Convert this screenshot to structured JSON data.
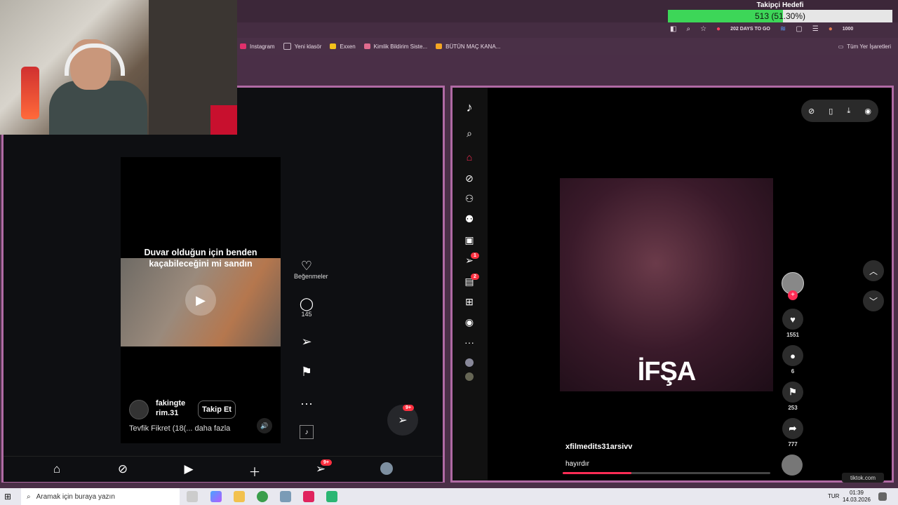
{
  "follower_goal": {
    "title": "Takipçi Hedefi",
    "text": "513 (51.30%)",
    "progress_fraction": 0.513
  },
  "toolbar": {
    "day_counter": "202 DAYS TO GO",
    "counter": "1000"
  },
  "bookmarks": {
    "items": [
      {
        "label": "Instagram",
        "color": "#e1306c"
      },
      {
        "label": "Yeni klasör",
        "color": "#c9b8c5"
      },
      {
        "label": "Exxen",
        "color": "#f3c11b"
      },
      {
        "label": "Kimlik Bildirim Siste...",
        "color": "#e06b8e"
      },
      {
        "label": "BÜTÜN MAÇ KANA...",
        "color": "#f5a623"
      }
    ],
    "all_label": "Tüm Yer İşaretleri"
  },
  "instagram": {
    "caption": "Duvar olduğun için benden kaçabileceğini mi sandın",
    "username": "fakingterim.31",
    "username_line1": "fakingte",
    "username_line2": "rim.31",
    "follow_label": "Takip Et",
    "description": "Tevfik Fikret (18(... daha fazla",
    "likes_label": "Beğenmeler",
    "comments": "145",
    "dm_badge": "9+",
    "nav_badge": "9+"
  },
  "tiktok": {
    "overlay_text": "İFŞA",
    "username": "xfilmedits31arsivv",
    "description": "hayırdır",
    "likes": "1551",
    "comments": "6",
    "saves": "253",
    "shares": "777",
    "messages_badge": "1",
    "inbox_badge": "2",
    "host": "tiktok.com",
    "progress_fraction": 0.33,
    "accent": "#fe2c55"
  },
  "taskbar": {
    "search_placeholder": "Aramak için buraya yazın",
    "lang": "TUR",
    "time": "01:39",
    "date": "14.03.2026"
  }
}
